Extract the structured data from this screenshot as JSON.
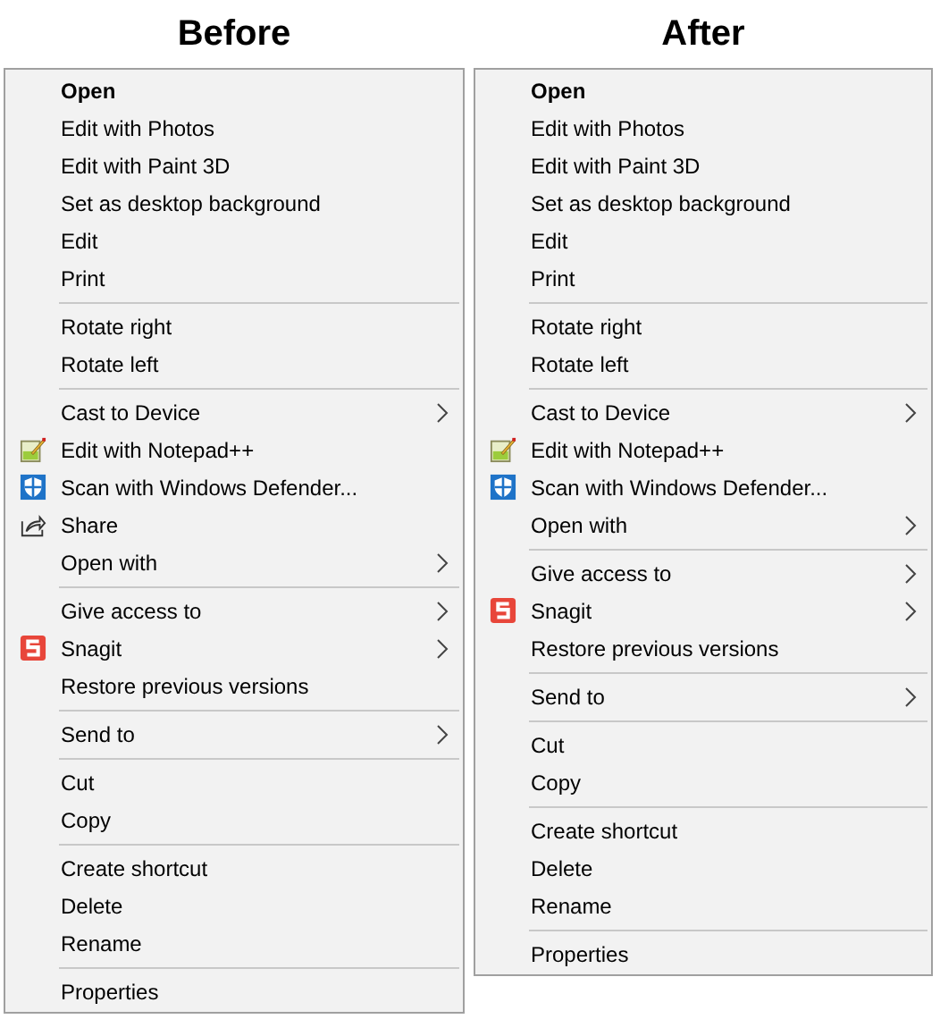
{
  "menus": [
    {
      "title": "Before",
      "sections": [
        [
          {
            "label": "Open",
            "default": true
          },
          {
            "label": "Edit with Photos"
          },
          {
            "label": "Edit with Paint 3D"
          },
          {
            "label": "Set as desktop background"
          },
          {
            "label": "Edit"
          },
          {
            "label": "Print"
          }
        ],
        [
          {
            "label": "Rotate right"
          },
          {
            "label": "Rotate left"
          }
        ],
        [
          {
            "label": "Cast to Device",
            "submenu": true
          },
          {
            "label": "Edit with Notepad++",
            "kind": "notepad"
          },
          {
            "label": "Scan with Windows Defender...",
            "kind": "shield"
          },
          {
            "label": "Share",
            "kind": "share"
          },
          {
            "label": "Open with",
            "submenu": true
          }
        ],
        [
          {
            "label": "Give access to",
            "submenu": true
          },
          {
            "label": "Snagit",
            "kind": "snagit",
            "submenu": true
          },
          {
            "label": "Restore previous versions"
          }
        ],
        [
          {
            "label": "Send to",
            "submenu": true
          }
        ],
        [
          {
            "label": "Cut"
          },
          {
            "label": "Copy"
          }
        ],
        [
          {
            "label": "Create shortcut"
          },
          {
            "label": "Delete"
          },
          {
            "label": "Rename"
          }
        ],
        [
          {
            "label": "Properties"
          }
        ]
      ]
    },
    {
      "title": "After",
      "sections": [
        [
          {
            "label": "Open",
            "default": true
          },
          {
            "label": "Edit with Photos"
          },
          {
            "label": "Edit with Paint 3D"
          },
          {
            "label": "Set as desktop background"
          },
          {
            "label": "Edit"
          },
          {
            "label": "Print"
          }
        ],
        [
          {
            "label": "Rotate right"
          },
          {
            "label": "Rotate left"
          }
        ],
        [
          {
            "label": "Cast to Device",
            "submenu": true
          },
          {
            "label": "Edit with Notepad++",
            "kind": "notepad"
          },
          {
            "label": "Scan with Windows Defender...",
            "kind": "shield"
          },
          {
            "label": "Open with",
            "submenu": true
          }
        ],
        [
          {
            "label": "Give access to",
            "submenu": true
          },
          {
            "label": "Snagit",
            "kind": "snagit",
            "submenu": true
          },
          {
            "label": "Restore previous versions"
          }
        ],
        [
          {
            "label": "Send to",
            "submenu": true
          }
        ],
        [
          {
            "label": "Cut"
          },
          {
            "label": "Copy"
          }
        ],
        [
          {
            "label": "Create shortcut"
          },
          {
            "label": "Delete"
          },
          {
            "label": "Rename"
          }
        ],
        [
          {
            "label": "Properties"
          }
        ]
      ]
    }
  ]
}
